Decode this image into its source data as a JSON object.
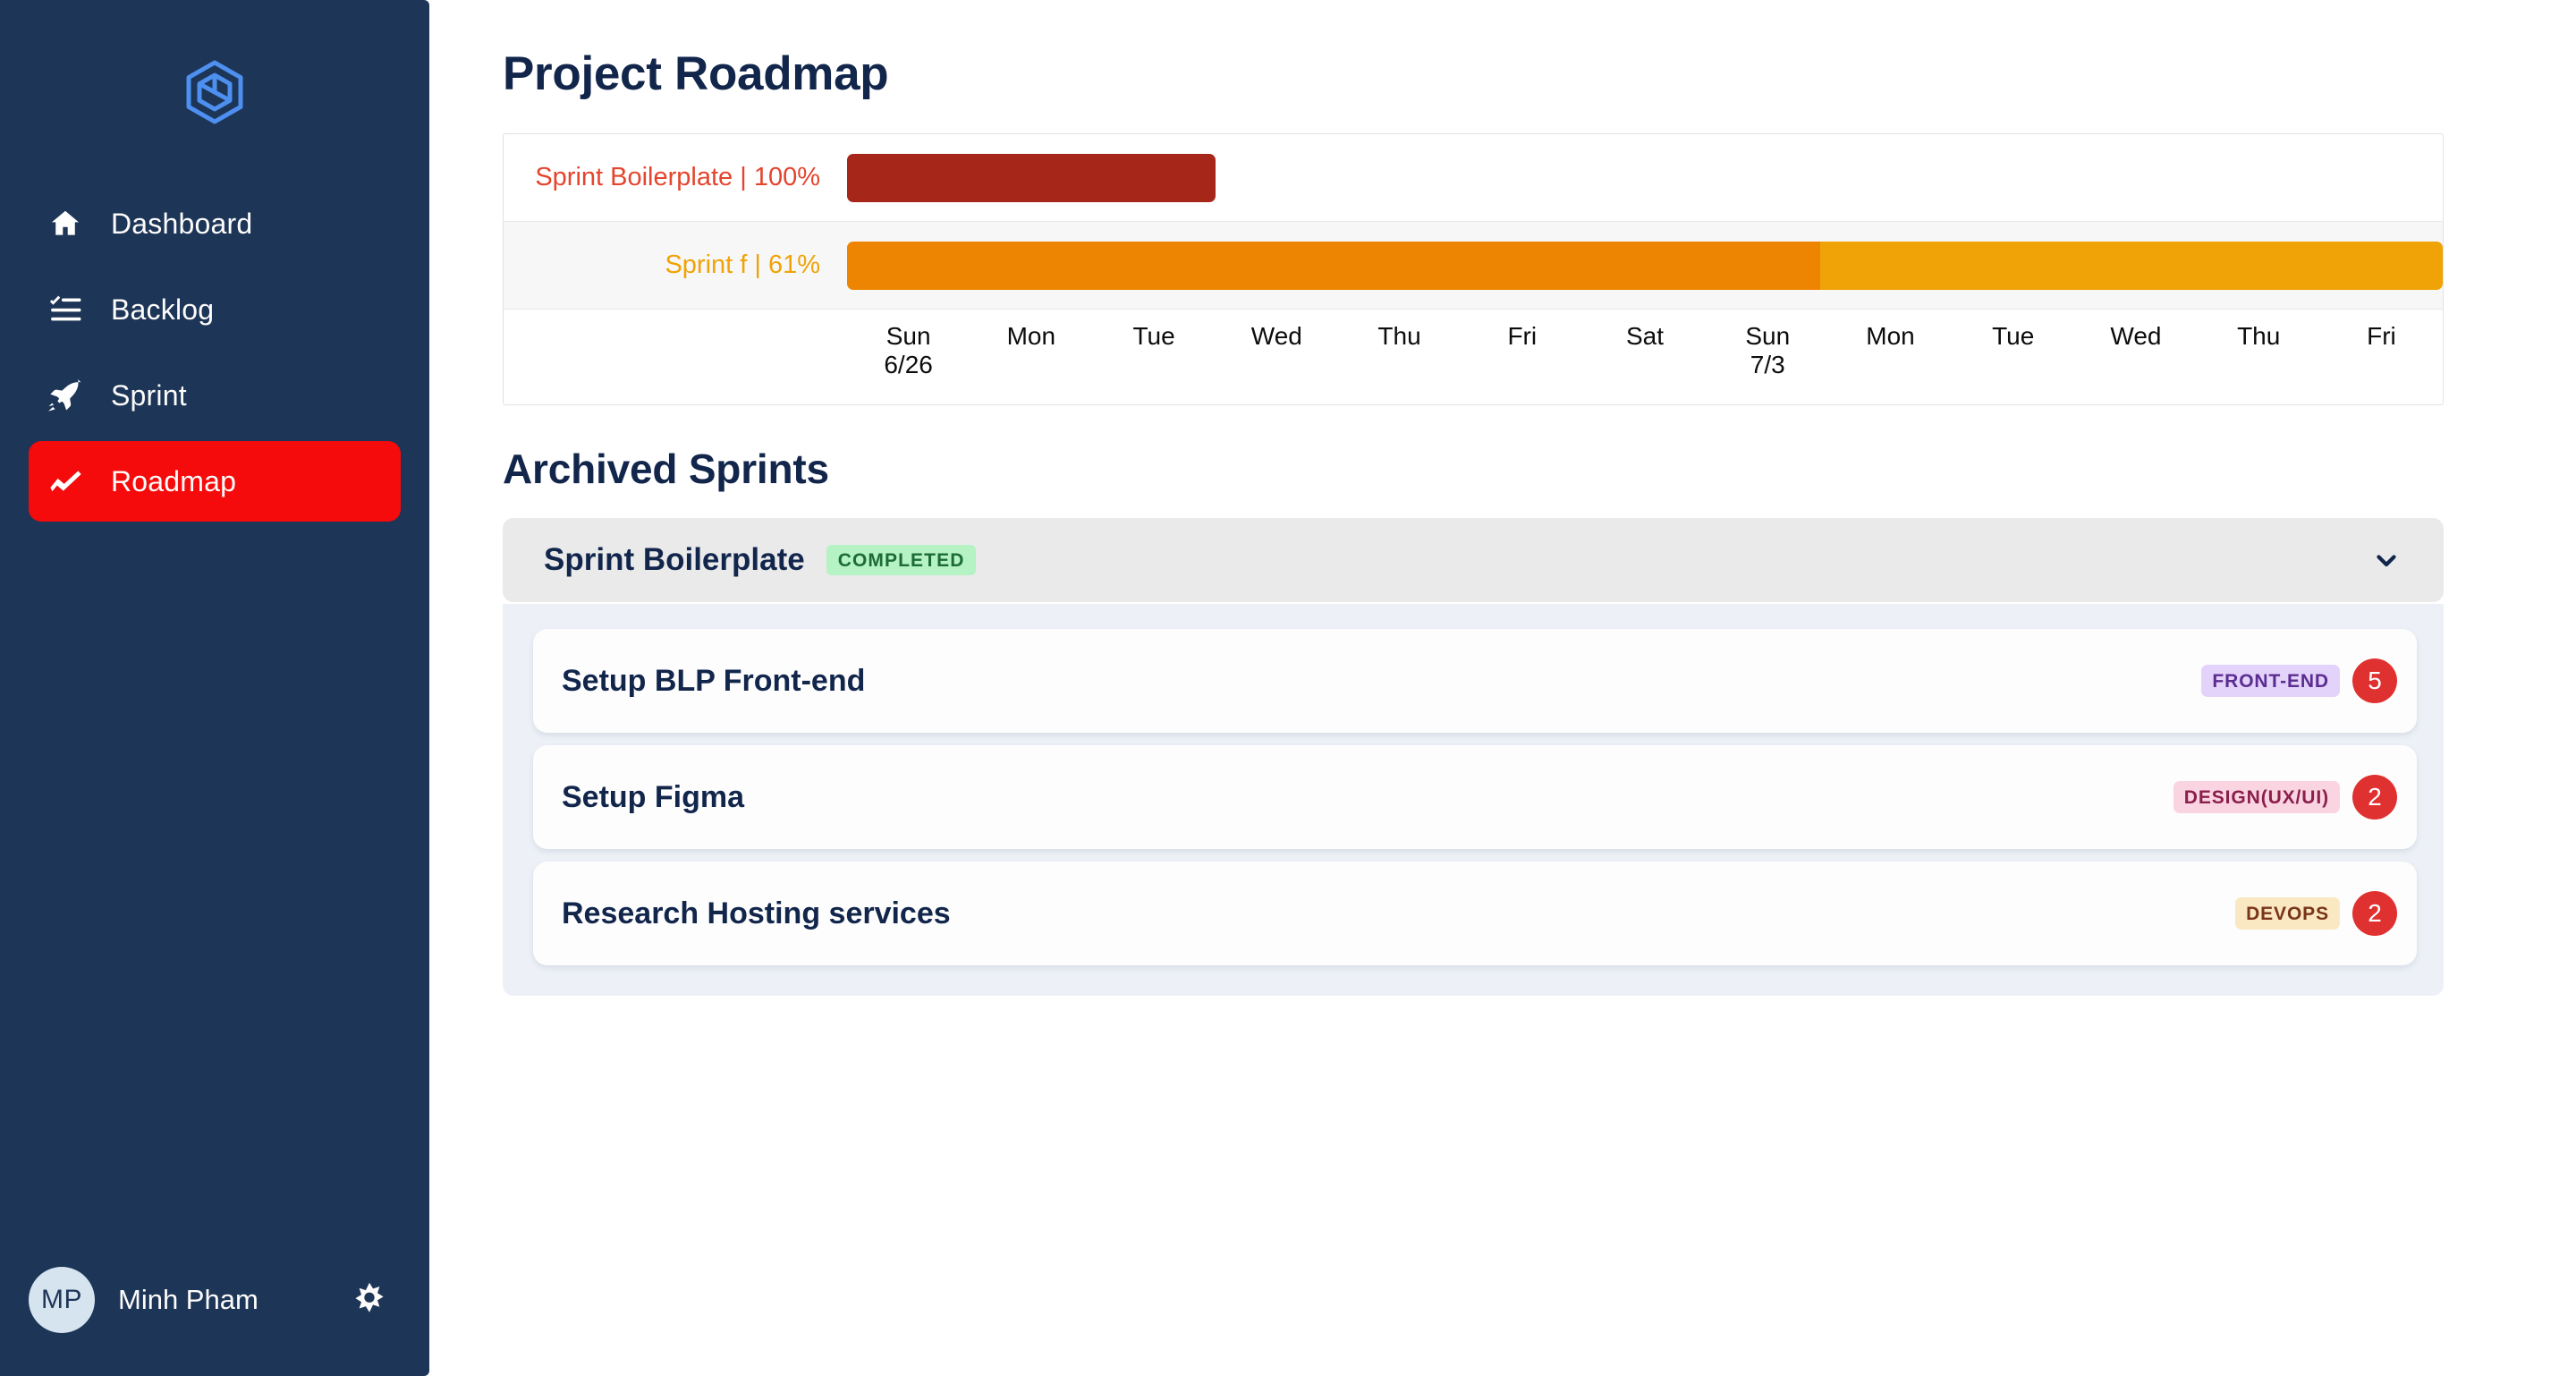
{
  "sidebar": {
    "logo_icon": "hexagon-cube-logo-icon",
    "items": [
      {
        "label": "Dashboard",
        "icon": "home-icon",
        "active": false
      },
      {
        "label": "Backlog",
        "icon": "checklist-icon",
        "active": false
      },
      {
        "label": "Sprint",
        "icon": "rocket-icon",
        "active": false
      },
      {
        "label": "Roadmap",
        "icon": "trending-line-icon",
        "active": true
      }
    ],
    "user": {
      "initials": "MP",
      "name": "Minh Pham",
      "settings_icon": "gear-icon"
    },
    "colors": {
      "background": "#1D3557",
      "active": "#F50B0B",
      "avatar_bg": "#D6E4F0"
    }
  },
  "main": {
    "page_title": "Project Roadmap",
    "section_title": "Archived Sprints"
  },
  "chart_data": {
    "type": "bar",
    "title": "Project Roadmap",
    "orientation": "horizontal",
    "subtype": "gantt",
    "xlabel": "",
    "ylabel": "",
    "categories": [
      "Sprint Boilerplate | 100%",
      "Sprint f | 61%"
    ],
    "series": [
      {
        "name": "Sprint Boilerplate",
        "label": "Sprint Boilerplate | 100%",
        "progress_percent": 100,
        "start_day_index": 0,
        "span_days": 3,
        "bar_color": "#A6261A",
        "remaining_color": "#A6261A",
        "label_color": "#E4452E"
      },
      {
        "name": "Sprint f",
        "label": "Sprint f | 61%",
        "progress_percent": 61,
        "start_day_index": 0,
        "span_days": 13,
        "bar_color": "#ED8402",
        "remaining_color": "#F0A306",
        "label_color": "#F0A306"
      }
    ],
    "x_ticks": [
      "Sun\n6/26",
      "Mon",
      "Tue",
      "Wed",
      "Thu",
      "Fri",
      "Sat",
      "Sun\n7/3",
      "Mon",
      "Tue",
      "Wed",
      "Thu",
      "Fri"
    ],
    "grid": false,
    "legend": "none",
    "row_stripes": true
  },
  "archived": {
    "sprint": {
      "title": "Sprint Boilerplate",
      "status": "COMPLETED",
      "status_colors": {
        "bg": "#B5F2C4",
        "text": "#1C6B36"
      },
      "expanded": true,
      "chevron_icon": "chevron-down-icon"
    },
    "tasks": [
      {
        "title": "Setup BLP Front-end",
        "tag": "FRONT-END",
        "tag_bg": "#E3D2FA",
        "tag_text": "#5B2D91",
        "points": "5"
      },
      {
        "title": "Setup Figma",
        "tag": "DESIGN(UX/UI)",
        "tag_bg": "#FBD4E1",
        "tag_text": "#8A1F4C",
        "points": "2"
      },
      {
        "title": "Research Hosting services",
        "tag": "DEVOPS",
        "tag_bg": "#FAE8C3",
        "tag_text": "#7A3418",
        "points": "2"
      }
    ],
    "points_badge_color": "#E03131"
  }
}
